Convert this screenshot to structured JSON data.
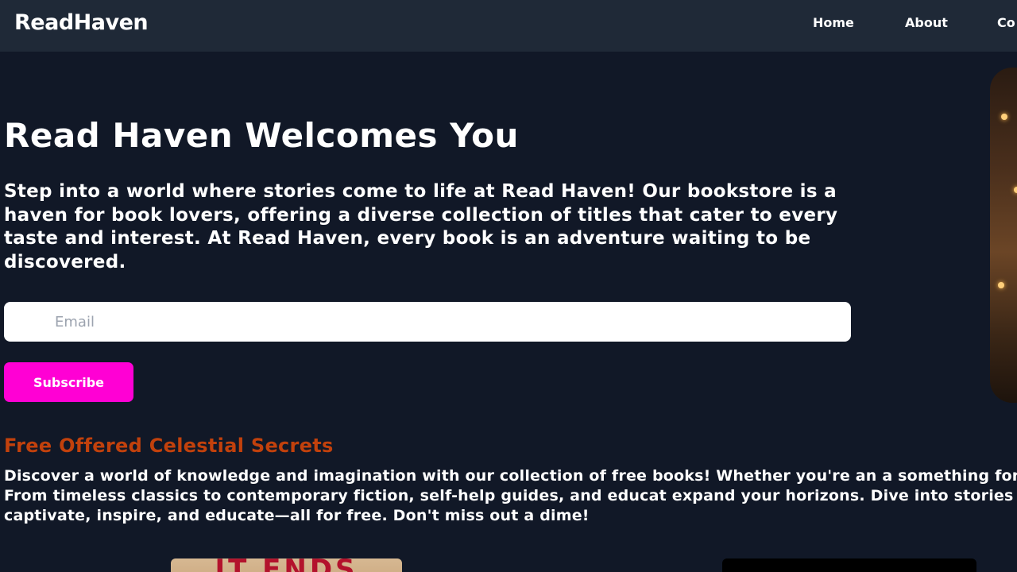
{
  "navbar": {
    "brand": "ReadHaven",
    "links": [
      {
        "label": "Home"
      },
      {
        "label": "About"
      },
      {
        "label": "Co"
      }
    ]
  },
  "hero": {
    "title": "Read Haven Welcomes You",
    "text": "Step into a world where stories come to life at Read Haven! Our bookstore is a haven for book lovers, offering a diverse collection of titles that cater to every taste and interest. At Read Haven, every book is an adventure waiting to be discovered.",
    "email_placeholder": "Email",
    "subscribe_label": "Subscribe"
  },
  "free_section": {
    "title": "Free Offered Celestial Secrets",
    "text": "Discover a world of knowledge and imagination with our collection of free books! Whether you're an a something for everyone. From timeless classics to contemporary fiction, self-help guides, and educat expand your horizons. Dive into stories that captivate, inspire, and educate—all for free. Don't miss out a dime!"
  },
  "books": [
    {
      "cover_text": "IT ENDS"
    },
    {
      "cover_text": ""
    }
  ],
  "colors": {
    "page_bg": "#111827",
    "navbar_bg": "#1f2937",
    "accent": "#ff00d4",
    "section_title": "#c2410c"
  }
}
